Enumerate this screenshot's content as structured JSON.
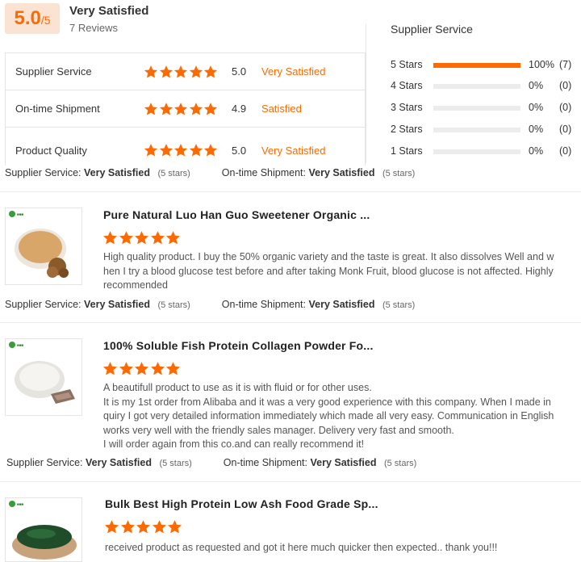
{
  "summary": {
    "score": "5.0",
    "score_suffix": "/5",
    "verdict": "Very Satisfied",
    "reviews": "7 Reviews"
  },
  "sub_ratings": [
    {
      "name": "Supplier Service",
      "score": "5.0",
      "verdict": "Very Satisfied",
      "stars": 5
    },
    {
      "name": "On-time Shipment",
      "score": "4.9",
      "verdict": "Satisfied",
      "stars": 5
    },
    {
      "name": "Product Quality",
      "score": "5.0",
      "verdict": "Very Satisfied",
      "stars": 5
    }
  ],
  "distribution": {
    "title": "Supplier Service",
    "rows": [
      {
        "label": "5 Stars",
        "pct": "100%",
        "count": "(7)",
        "fraction": 1.0
      },
      {
        "label": "4 Stars",
        "pct": "0%",
        "count": "(0)",
        "fraction": 0
      },
      {
        "label": "3 Stars",
        "pct": "0%",
        "count": "(0)",
        "fraction": 0
      },
      {
        "label": "2 Stars",
        "pct": "0%",
        "count": "(0)",
        "fraction": 0
      },
      {
        "label": "1 Stars",
        "pct": "0%",
        "count": "(0)",
        "fraction": 0
      }
    ]
  },
  "labels": {
    "supplier_service": "Supplier Service:",
    "ontime_shipment": "On-time Shipment:",
    "very_satisfied": "Very Satisfied",
    "five_stars": "(5 stars)"
  },
  "reviews": [
    {
      "title": "Pure Natural Luo Han Guo Sweetener Organic ...",
      "stars": 5,
      "lines": [
        "High quality product. I buy the 50% organic variety and the taste is great. It also dissolves Well and w",
        "hen I try a blood glucose test before and after taking Monk Fruit, blood glucose is not affected. Highly",
        "recommended"
      ],
      "thumb_color": "#d9a66a"
    },
    {
      "title": "100% Soluble Fish Protein Collagen Powder Fo...",
      "stars": 5,
      "lines": [
        "A beautifull product to use as it is with fluid or for other uses.",
        "It is my 1st order from Alibaba and it was a very good experience with this company. When I made in",
        "quiry I got very detailed information immediately which made all very easy. Communication in English",
        "works very well with the friendly sales manager. Delivery very fast and smooth.",
        "I will order again from this co.and can really recommend it!"
      ],
      "thumb_color": "#f2efe9"
    },
    {
      "title": "Bulk Best High Protein Low Ash Food Grade Sp...",
      "stars": 5,
      "lines": [
        "received product as requested and got it here much quicker then expected.. thank you!!!"
      ],
      "thumb_color": "#1f4d2a"
    }
  ],
  "colors": {
    "accent": "#ff6a00",
    "score_bg": "#fbe3d4"
  }
}
